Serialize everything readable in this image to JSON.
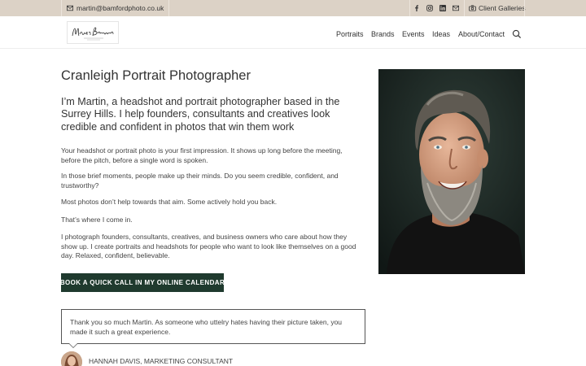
{
  "topbar": {
    "email": "martin@bamfordphoto.co.uk",
    "email_icon": "envelope-icon",
    "social_icons": [
      "facebook-icon",
      "instagram-icon",
      "linkedin-icon",
      "email-icon"
    ],
    "gallery_icon": "camera-icon",
    "gallery_label": "Client Galleries",
    "background": "#dcd2c6"
  },
  "header": {
    "logo_text": "Martin Bamford",
    "nav": [
      "Portraits",
      "Brands",
      "Events",
      "Ideas",
      "About/Contact"
    ],
    "search_icon": "search-icon"
  },
  "main": {
    "title": "Cranleigh Portrait Photographer",
    "lead": "I’m Martin, a headshot and portrait photographer based in the Surrey Hills. I help founders, consultants and creatives look credible and confident in photos that win them work",
    "paragraphs": [
      "Your headshot or portrait photo is your first impression. It shows up long before the meeting, before the pitch, before a single word is spoken.",
      "In those brief moments, people make up their minds. Do you seem credible, confident, and trustworthy?",
      "Most photos don’t help towards that aim. Some actively hold you back.",
      "That’s where I come in.",
      "I photograph founders, consultants, creatives, and business owners who care about how they show up. I create portraits and headshots for people who want to look like themselves on a good day. Relaxed, confident, believable."
    ],
    "cta_label": "BOOK A QUICK CALL IN MY ONLINE CALENDAR",
    "cta_color": "#1f3a2e"
  },
  "testimonial": {
    "quote": "Thank you so much Martin. As someone who uttelry hates having their picture taken, you made it such a great experience.",
    "author": "HANNAH DAVIS, MARKETING CONSULTANT"
  }
}
